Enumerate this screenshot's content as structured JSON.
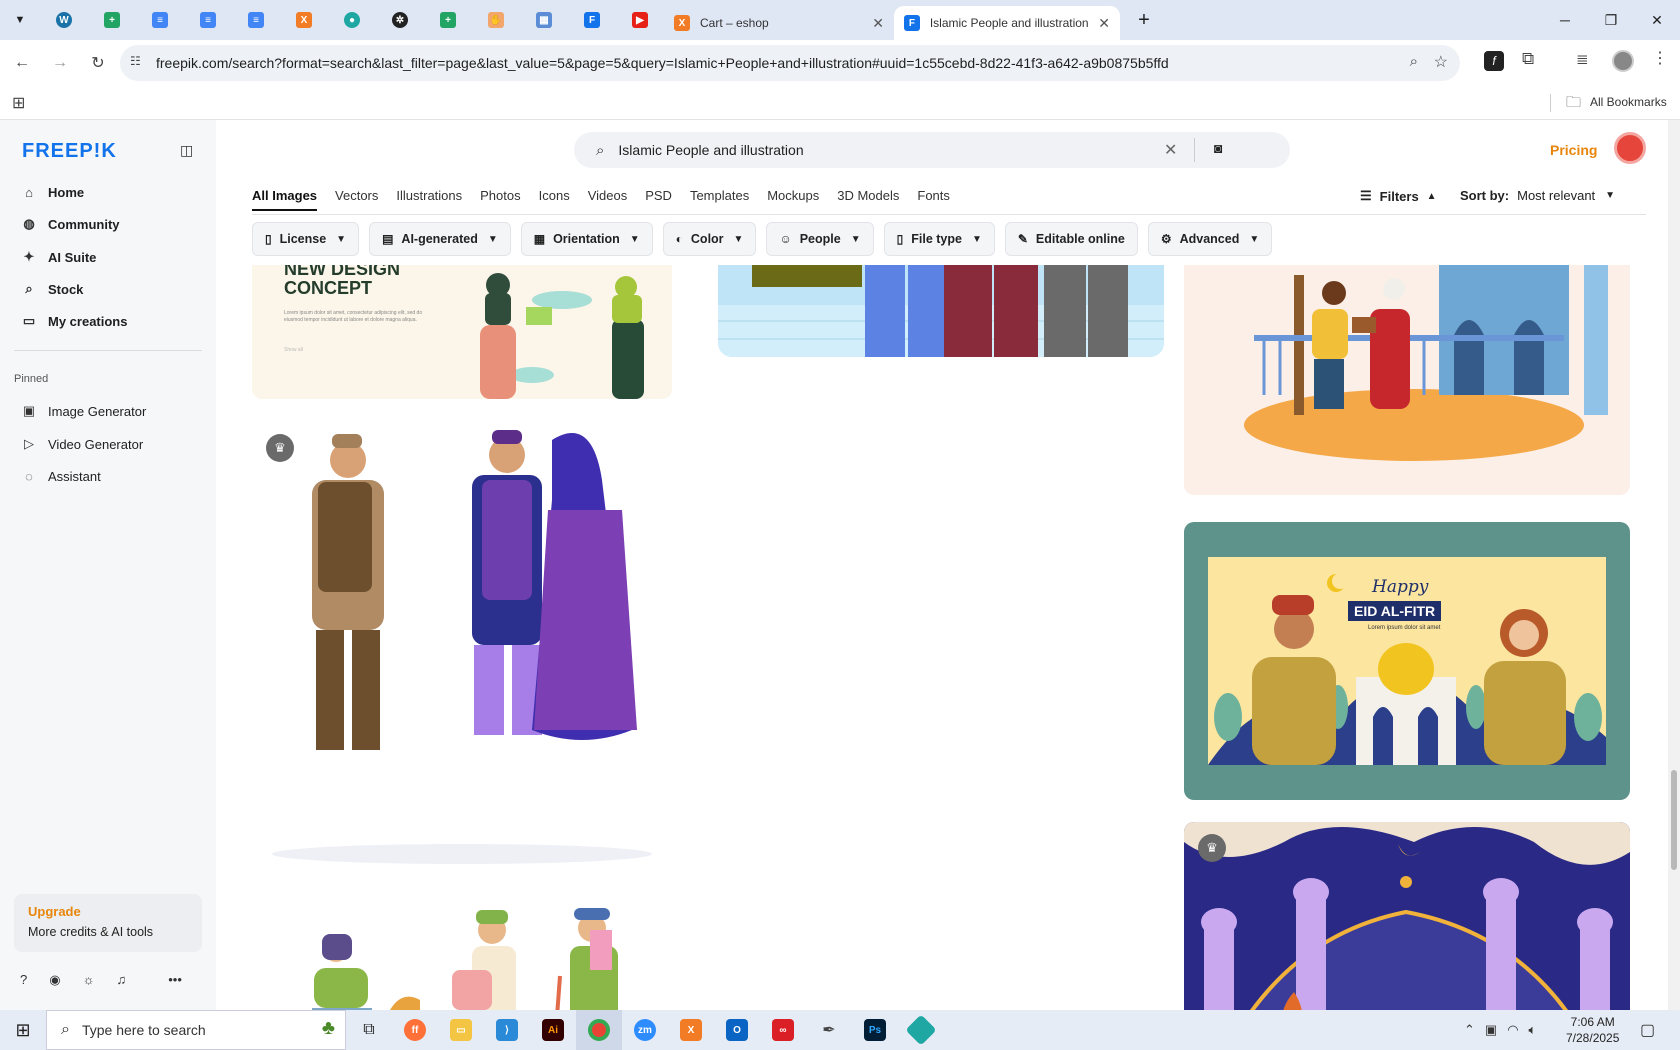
{
  "browser": {
    "tabs": [
      {
        "label": "Cart – eshop"
      },
      {
        "label": "Islamic People and illustration"
      }
    ],
    "url": "freepik.com/search?format=search&last_filter=page&last_value=5&page=5&query=Islamic+People+and+illustration#uuid=1c55cebd-8d22-41f3-a642-a9b0875b5ffd",
    "all_bookmarks": "All Bookmarks"
  },
  "sidebar": {
    "logo": "FREEP!K",
    "items": [
      {
        "label": "Home"
      },
      {
        "label": "Community"
      },
      {
        "label": "AI Suite"
      },
      {
        "label": "Stock"
      },
      {
        "label": "My creations"
      }
    ],
    "pinned_heading": "Pinned",
    "pinned": [
      {
        "label": "Image Generator"
      },
      {
        "label": "Video Generator"
      },
      {
        "label": "Assistant"
      }
    ],
    "upgrade_title": "Upgrade",
    "upgrade_sub": "More credits & AI tools"
  },
  "header": {
    "search_value": "Islamic People and illustration",
    "pricing": "Pricing"
  },
  "categories": [
    "All Images",
    "Vectors",
    "Illustrations",
    "Photos",
    "Icons",
    "Videos",
    "PSD",
    "Templates",
    "Mockups",
    "3D Models",
    "Fonts"
  ],
  "filters": {
    "label": "Filters",
    "sort_label": "Sort by:",
    "sort_value": "Most relevant",
    "chips": [
      "License",
      "AI-generated",
      "Orientation",
      "Color",
      "People",
      "File type",
      "Editable online",
      "Advanced"
    ]
  },
  "cards": {
    "concept_title_1": "NEW DESIGN",
    "concept_title_2": "CONCEPT",
    "concept_body": "Lorem ipsum dolor sit amet, consectetur adipiscing elit, sed do eiusmod tempor incididunt ut labore et dolore magna aliqua.",
    "concept_link": "Show all",
    "eid_happy": "Happy",
    "eid_title": "EID AL-FITR",
    "eid_sub": "Lorem ipsum dolor sit amet"
  },
  "taskbar": {
    "search_placeholder": "Type here to search",
    "time": "7:06 AM",
    "date": "7/28/2025"
  }
}
